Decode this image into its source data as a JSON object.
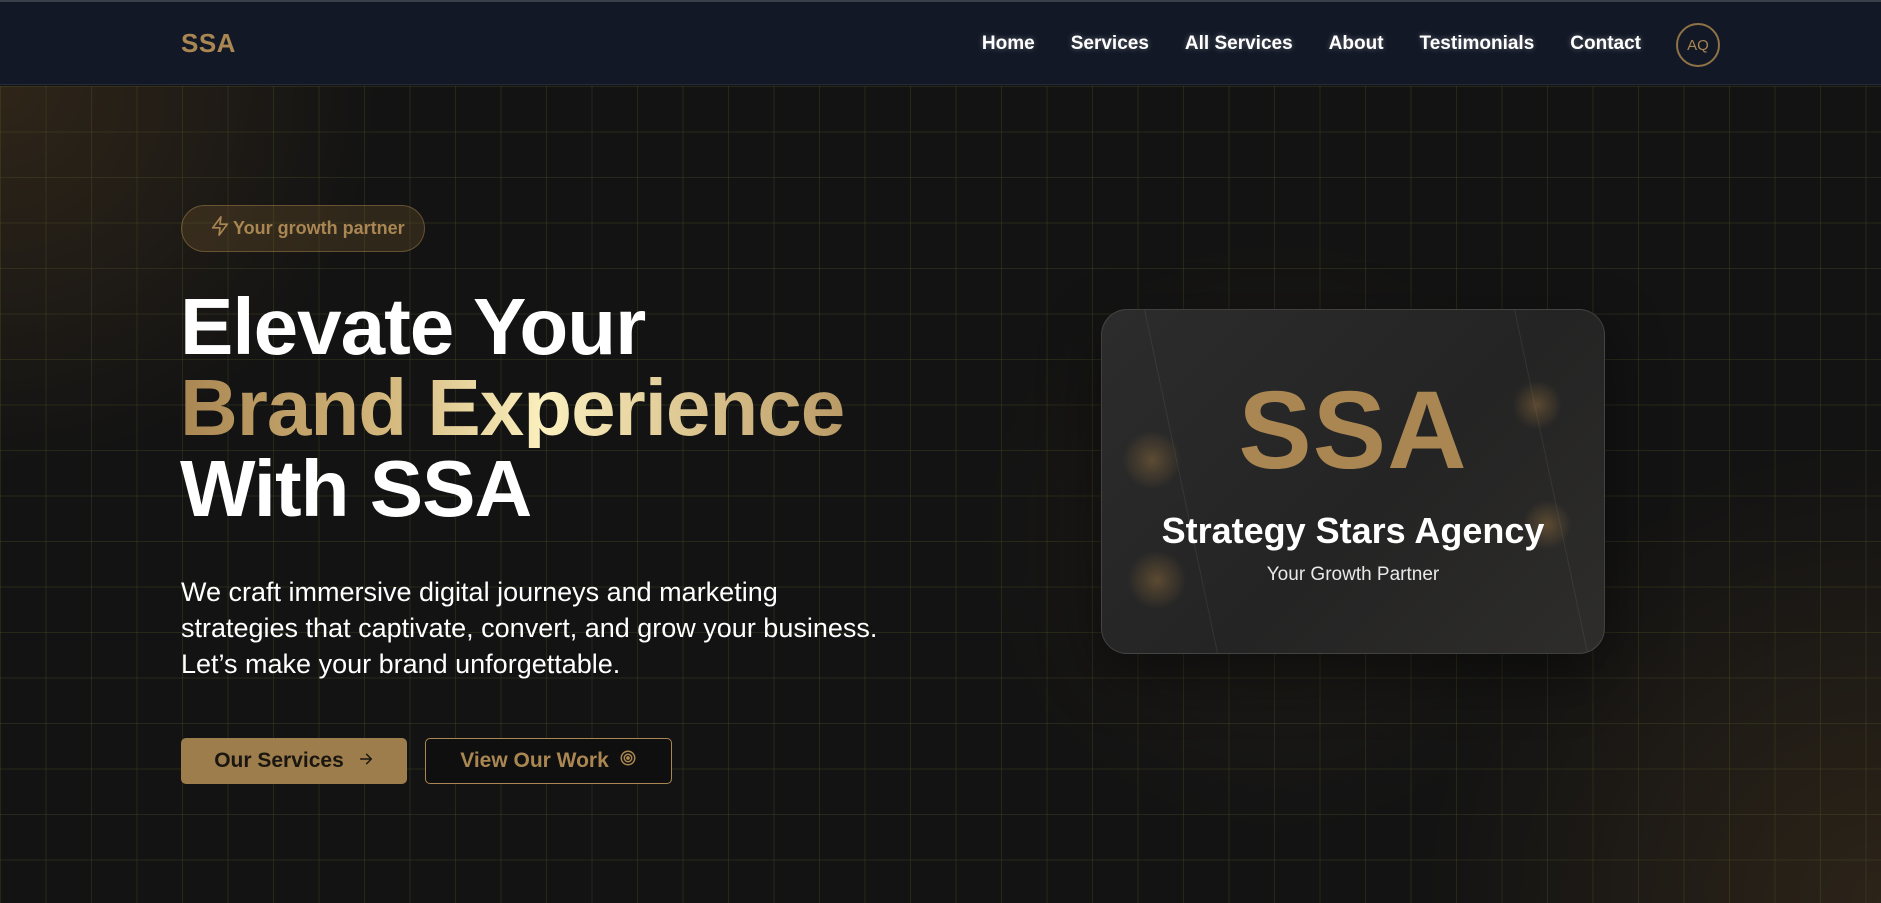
{
  "colors": {
    "accent": "#a98652",
    "navbar_bg": "#121826",
    "page_bg": "#131313"
  },
  "navbar": {
    "logo": "SSA",
    "links": [
      "Home",
      "Services",
      "All Services",
      "About",
      "Testimonials",
      "Contact"
    ],
    "avatar_initials": "AQ"
  },
  "hero": {
    "badge": {
      "icon": "lightning-bolt-icon",
      "label": "Your growth partner"
    },
    "headline": {
      "line1": "Elevate Your",
      "line2": "Brand Experience",
      "line3": "With SSA"
    },
    "lead": "We craft immersive digital journeys and marketing strategies that captivate, convert, and grow your business. Let’s make your brand unforgettable.",
    "buttons": {
      "primary": {
        "label": "Our Services",
        "icon": "arrow-right-icon"
      },
      "secondary": {
        "label": "View Our Work",
        "icon": "target-icon"
      }
    }
  },
  "card": {
    "logo": "SSA",
    "title": "Strategy Stars Agency",
    "subtitle": "Your Growth Partner"
  }
}
